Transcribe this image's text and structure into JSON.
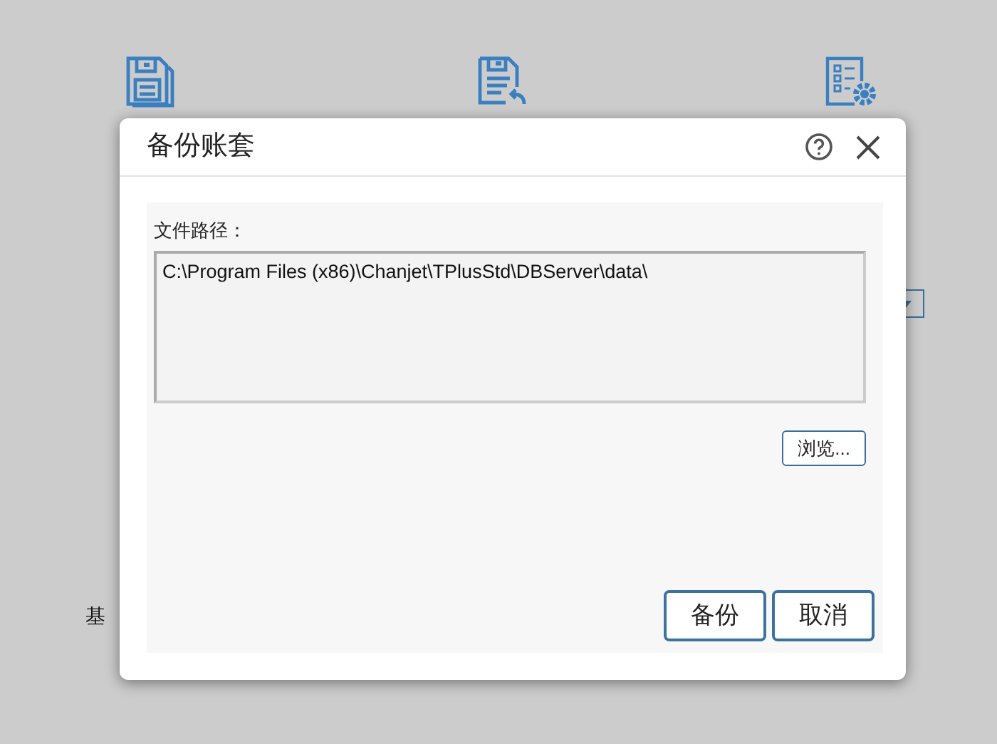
{
  "background": {
    "labels": [
      "基"
    ]
  },
  "dialog": {
    "title": "备份账套",
    "path_field": {
      "label": "文件路径：",
      "value": "C:\\Program Files (x86)\\Chanjet\\TPlusStd\\DBServer\\data\\"
    },
    "browse_button": "浏览...",
    "buttons": [
      "备份",
      "取消"
    ]
  }
}
